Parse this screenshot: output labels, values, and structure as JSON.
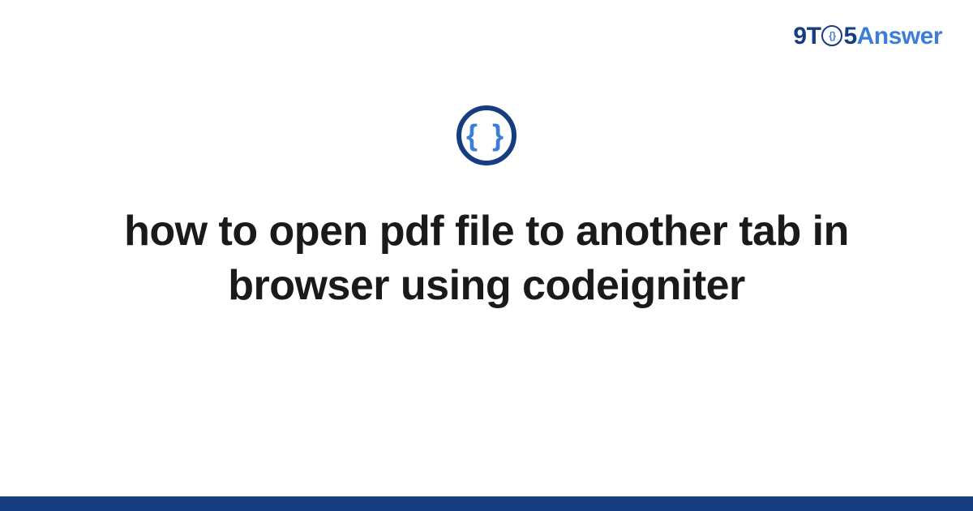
{
  "logo": {
    "part1": "9T",
    "part_o_inner": "{}",
    "part5": "5",
    "answer": "Answer"
  },
  "icon": {
    "braces": "{ }"
  },
  "title": "how to open pdf file to another tab in browser using codeigniter"
}
